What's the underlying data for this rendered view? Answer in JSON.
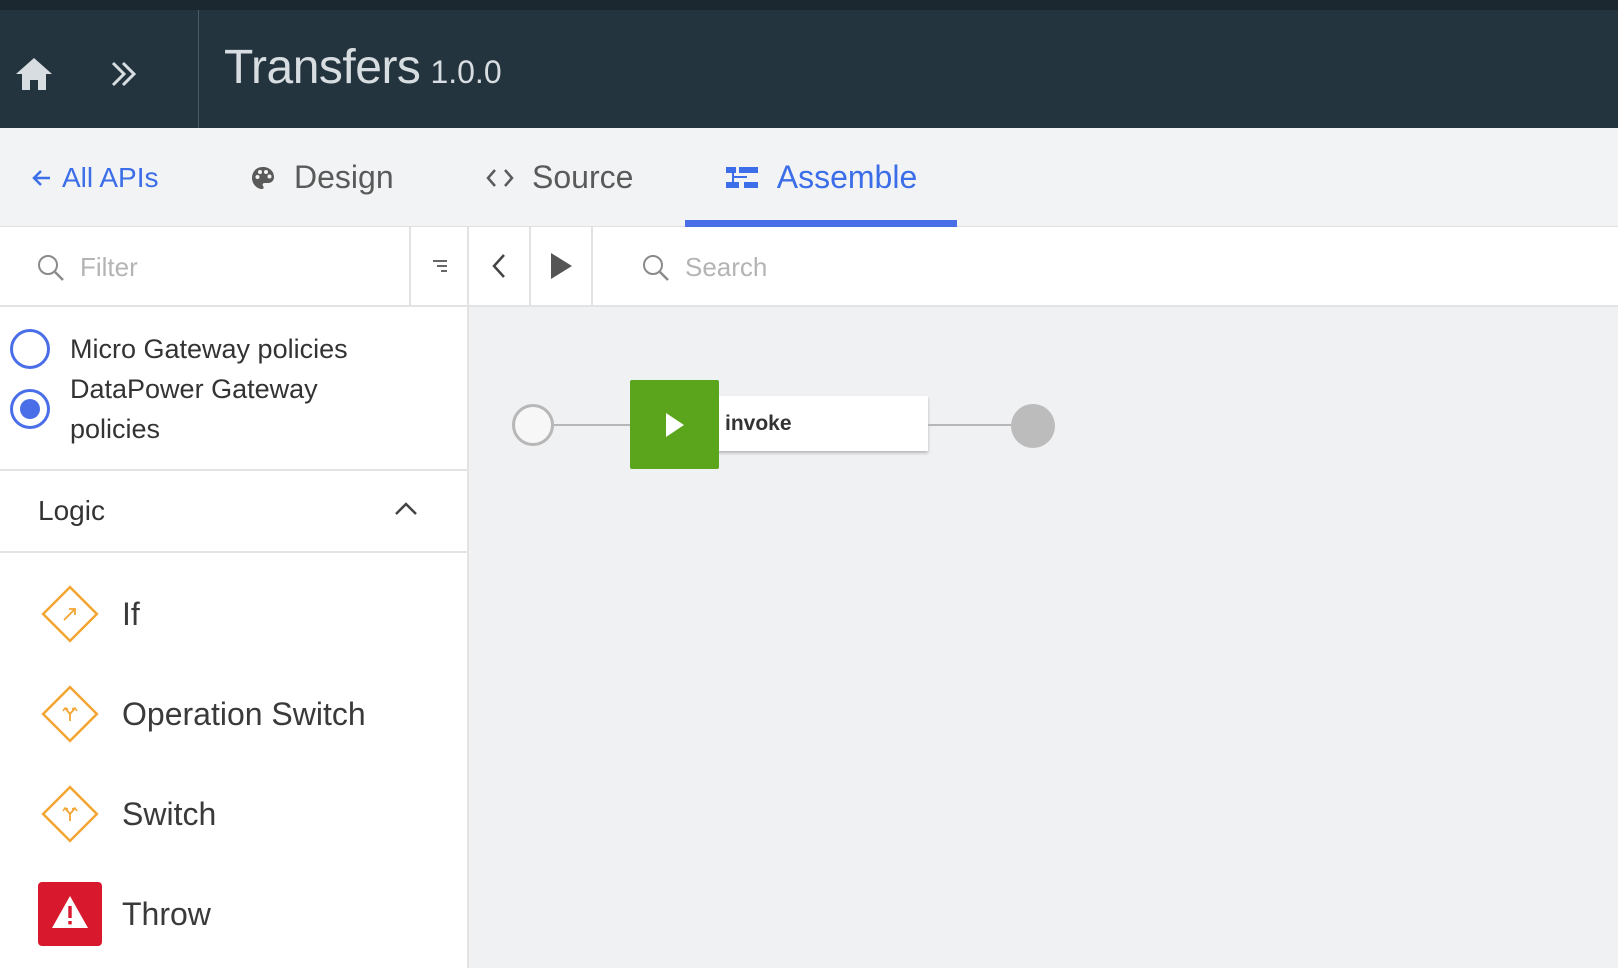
{
  "header": {
    "api_name": "Transfers",
    "api_version": "1.0.0"
  },
  "tabs": {
    "back_label": "All APIs",
    "design_label": "Design",
    "source_label": "Source",
    "assemble_label": "Assemble",
    "active": "Assemble"
  },
  "palette": {
    "filter_placeholder": "Filter",
    "gateway_options": [
      {
        "label": "Micro Gateway policies",
        "selected": false
      },
      {
        "label": "DataPower Gateway policies",
        "selected": true
      }
    ],
    "section": {
      "label": "Logic",
      "expanded": true
    },
    "policies": [
      {
        "label": "If",
        "icon": "if-diamond-icon"
      },
      {
        "label": "Operation Switch",
        "icon": "operation-switch-diamond-icon"
      },
      {
        "label": "Switch",
        "icon": "switch-diamond-icon"
      },
      {
        "label": "Throw",
        "icon": "throw-warning-icon"
      }
    ]
  },
  "canvas": {
    "search_placeholder": "Search",
    "flow": [
      {
        "type": "invoke",
        "label": "invoke"
      }
    ]
  },
  "colors": {
    "header_bg": "#24343e",
    "accent": "#4a6ee8",
    "logic_orange": "#f2a531",
    "invoke_green": "#5aa51c",
    "throw_red": "#d8182d",
    "canvas_bg": "#f0f1f3"
  }
}
